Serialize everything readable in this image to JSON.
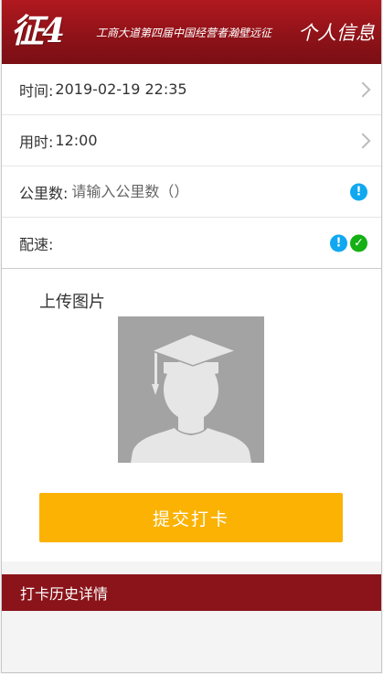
{
  "header": {
    "logo_text": "征4",
    "slogan": "工商大道第四届中国经营者瀚壁远征",
    "profile_link": "个人信息"
  },
  "form": {
    "time": {
      "label": "时间:",
      "value": "2019-02-19 22:35"
    },
    "duration": {
      "label": "用时:",
      "value": "12:00"
    },
    "distance": {
      "label": "公里数:",
      "placeholder": "请输入公里数（）",
      "value": ""
    },
    "pace": {
      "label": "配速:",
      "value": ""
    }
  },
  "upload": {
    "title": "上传图片"
  },
  "submit_button": "提交打卡",
  "history_bar": "打卡历史详情",
  "colors": {
    "header_red": "#8d1218",
    "submit_yellow": "#fbb202",
    "info_blue": "#10a8f0",
    "success_green": "#14b014"
  }
}
